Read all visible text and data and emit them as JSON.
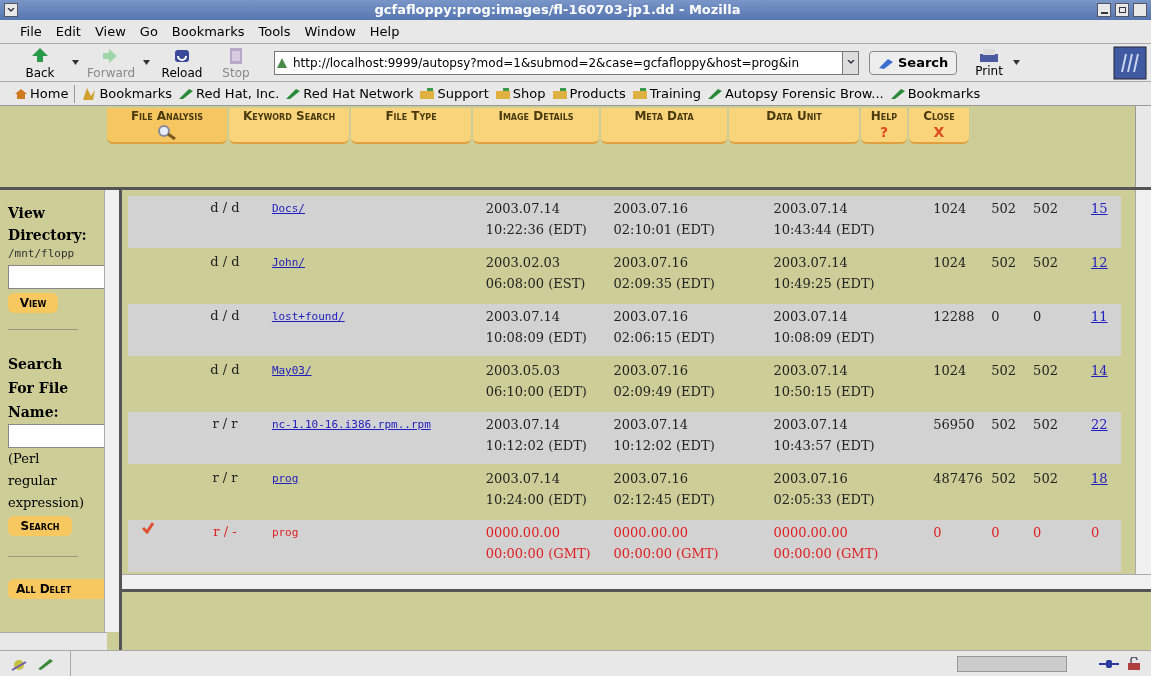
{
  "window": {
    "title": "gcfafloppy:prog:images/fl-160703-jp1.dd - Mozilla"
  },
  "menu": [
    "File",
    "Edit",
    "View",
    "Go",
    "Bookmarks",
    "Tools",
    "Window",
    "Help"
  ],
  "toolbar": {
    "buttons": [
      {
        "label": "Back",
        "disabled": false
      },
      {
        "label": "Forward",
        "disabled": true
      },
      {
        "label": "Reload",
        "disabled": false
      },
      {
        "label": "Stop",
        "disabled": true
      }
    ],
    "url": "http://localhost:9999/autopsy?mod=1&submod=2&case=gcfafloppy&host=prog&in",
    "search": "Search",
    "print": "Print"
  },
  "bookmarks": [
    {
      "label": "Home",
      "kind": "home"
    },
    {
      "label": "Bookmarks",
      "kind": "bookmarks"
    },
    {
      "label": "Red Hat, Inc.",
      "kind": "link"
    },
    {
      "label": "Red Hat Network",
      "kind": "link"
    },
    {
      "label": "Support",
      "kind": "folder"
    },
    {
      "label": "Shop",
      "kind": "folder"
    },
    {
      "label": "Products",
      "kind": "folder"
    },
    {
      "label": "Training",
      "kind": "folder"
    },
    {
      "label": "Autopsy Forensic Brow...",
      "kind": "link"
    },
    {
      "label": "Bookmarks",
      "kind": "link"
    }
  ],
  "tabs": [
    {
      "label": "File Analysis",
      "selected": true
    },
    {
      "label": "Keyword Search",
      "selected": false
    },
    {
      "label": "File Type",
      "selected": false
    },
    {
      "label": "Image Details",
      "selected": false
    },
    {
      "label": "Meta Data",
      "selected": false
    },
    {
      "label": "Data Unit",
      "selected": false
    },
    {
      "label": "Help",
      "selected": false,
      "sub": "?"
    },
    {
      "label": "Close",
      "selected": false,
      "sub": "X"
    }
  ],
  "sidebar": {
    "view_label": "View Directory:",
    "path": "/mnt/flopp",
    "view_button": "View",
    "search_label": "Search For File Name:",
    "hint": "(Perl regular expression)",
    "search_button": "Search",
    "all_deleted_button": "All Delet"
  },
  "rows": [
    {
      "deleted": false,
      "type": "d / d",
      "name": "Docs/",
      "written": [
        "2003.07.14",
        "10:22:36 (EDT)"
      ],
      "accessed": [
        "2003.07.16",
        "02:10:01 (EDT)"
      ],
      "changed": [
        "2003.07.14",
        "10:43:44 (EDT)"
      ],
      "size": "1024",
      "uid": "502",
      "gid": "502",
      "meta": "15"
    },
    {
      "deleted": false,
      "type": "d / d",
      "name": "John/",
      "written": [
        "2003.02.03",
        "06:08:00 (EST)"
      ],
      "accessed": [
        "2003.07.16",
        "02:09:35 (EDT)"
      ],
      "changed": [
        "2003.07.14",
        "10:49:25 (EDT)"
      ],
      "size": "1024",
      "uid": "502",
      "gid": "502",
      "meta": "12"
    },
    {
      "deleted": false,
      "type": "d / d",
      "name": "lost+found/",
      "written": [
        "2003.07.14",
        "10:08:09 (EDT)"
      ],
      "accessed": [
        "2003.07.16",
        "02:06:15 (EDT)"
      ],
      "changed": [
        "2003.07.14",
        "10:08:09 (EDT)"
      ],
      "size": "12288",
      "uid": "0",
      "gid": "0",
      "meta": "11"
    },
    {
      "deleted": false,
      "type": "d / d",
      "name": "May03/",
      "written": [
        "2003.05.03",
        "06:10:00 (EDT)"
      ],
      "accessed": [
        "2003.07.16",
        "02:09:49 (EDT)"
      ],
      "changed": [
        "2003.07.14",
        "10:50:15 (EDT)"
      ],
      "size": "1024",
      "uid": "502",
      "gid": "502",
      "meta": "14"
    },
    {
      "deleted": false,
      "type": "r / r",
      "name": "nc-1.10-16.i386.rpm..rpm",
      "written": [
        "2003.07.14",
        "10:12:02 (EDT)"
      ],
      "accessed": [
        "2003.07.14",
        "10:12:02 (EDT)"
      ],
      "changed": [
        "2003.07.14",
        "10:43:57 (EDT)"
      ],
      "size": "56950",
      "uid": "502",
      "gid": "502",
      "meta": "22"
    },
    {
      "deleted": false,
      "type": "r / r",
      "name": "prog",
      "written": [
        "2003.07.14",
        "10:24:00 (EDT)"
      ],
      "accessed": [
        "2003.07.16",
        "02:12:45 (EDT)"
      ],
      "changed": [
        "2003.07.16",
        "02:05:33 (EDT)"
      ],
      "size": "487476",
      "uid": "502",
      "gid": "502",
      "meta": "18"
    },
    {
      "deleted": true,
      "type": "r / -",
      "name": "prog",
      "written": [
        "0000.00.00",
        "00:00:00 (GMT)"
      ],
      "accessed": [
        "0000.00.00",
        "00:00:00 (GMT)"
      ],
      "changed": [
        "0000.00.00",
        "00:00:00 (GMT)"
      ],
      "size": "0",
      "uid": "0",
      "gid": "0",
      "meta": "0"
    }
  ]
}
